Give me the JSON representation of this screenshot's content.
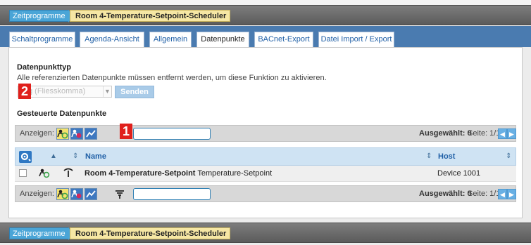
{
  "breadcrumb": {
    "root": "Zeitprogramme",
    "item": "Room 4-Temperature-Setpoint-Scheduler"
  },
  "tabs": [
    {
      "label": "Schaltprogramme"
    },
    {
      "label": "Agenda-Ansicht"
    },
    {
      "label": "Allgemein"
    },
    {
      "label": "Datenpunkte",
      "active": true
    },
    {
      "label": "BACnet-Export"
    },
    {
      "label": "Datei Import / Export"
    }
  ],
  "datapoint_type": {
    "title": "Datenpunkttyp",
    "hint": "Alle referenzierten Datenpunkte müssen entfernt werden, um diese Funktion zu aktivieren.",
    "select_value": "g (Fliesskomma)",
    "send_label": "Senden"
  },
  "controlled": {
    "title": "Gesteuerte Datenpunkte"
  },
  "toolbar_top": {
    "show_label": "Anzeigen:",
    "selected_label": "Ausgewählt: 0",
    "page_label": "Seite: 1/1",
    "search_value": ""
  },
  "table": {
    "columns": {
      "name": "Name",
      "host": "Host"
    },
    "rows": [
      {
        "name_bold": "Room 4-Temperature-Setpoint",
        "name_rest": "Temperature-Setpoint",
        "host": "Device 1001"
      }
    ]
  },
  "toolbar_bottom": {
    "show_label": "Anzeigen:",
    "selected_label": "Ausgewählt: 0",
    "page_label": "Seite: 1/1",
    "search_value": ""
  },
  "markers": [
    "1",
    "2"
  ],
  "colors": {
    "accent_blue": "#4aa5d7",
    "crumb_yellow": "#f6e7a4",
    "tabbar_blue": "#4a7bb0",
    "marker_red": "#e0201c"
  },
  "icons": {
    "filter_yellow": "person-check-icon",
    "filter_blue": "person-blocked-icon",
    "filter_chart": "trend-icon",
    "row_type": "person-check-icon",
    "row_link": "antenna-icon",
    "funnel": "funnel-icon",
    "settings": "gear-icon"
  }
}
